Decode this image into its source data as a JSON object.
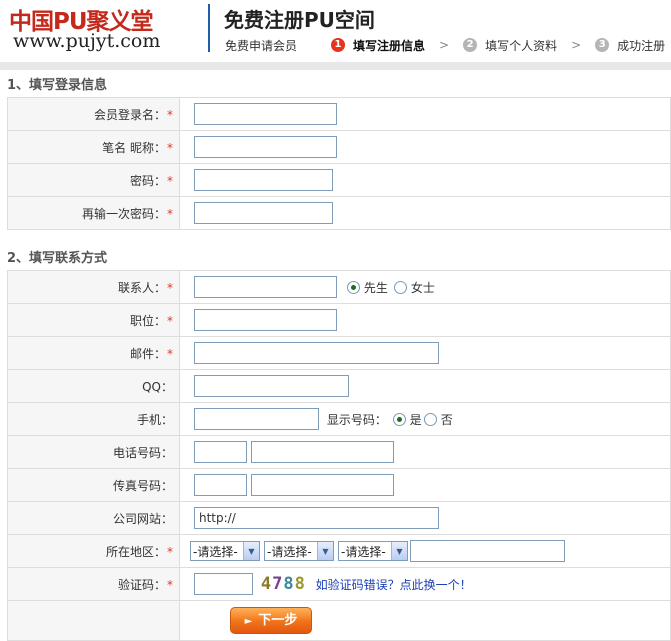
{
  "header": {
    "logo_cn": "中国PU聚义堂",
    "logo_url": "www.pujyt.com",
    "title": "免费注册PU空间",
    "steps": [
      {
        "num": "",
        "label": "免费申请会员"
      },
      {
        "num": "1",
        "label": "填写注册信息"
      },
      {
        "num": "2",
        "label": "填写个人资料"
      },
      {
        "num": "3",
        "label": "成功注册"
      }
    ],
    "separator": ">"
  },
  "section1": {
    "title": "1、填写登录信息",
    "fields": {
      "username": "会员登录名：",
      "nickname": "笔名 昵称：",
      "password": "密码：",
      "password2": "再输一次密码："
    }
  },
  "section2": {
    "title": "2、填写联系方式",
    "fields": {
      "contact": "联系人：",
      "position": "职位：",
      "email": "邮件：",
      "qq": "QQ：",
      "mobile": "手机：",
      "phone": "电话号码：",
      "fax": "传真号码：",
      "website": "公司网站：",
      "region": "所在地区：",
      "captcha": "验证码："
    },
    "gender": {
      "male": "先生",
      "female": "女士",
      "selected": "male"
    },
    "show_number": {
      "label": "显示号码：",
      "yes": "是",
      "no": "否",
      "selected": "yes"
    },
    "website_value": "http://",
    "region_selects": [
      "-请选择-",
      "-请选择-",
      "-请选择-"
    ],
    "captcha_code": [
      "4",
      "7",
      "8",
      "8"
    ],
    "captcha_colors": [
      "#8a7a2a",
      "#7a3f8f",
      "#3a8a9a",
      "#9a9a2a"
    ],
    "captcha_link": "如验证码错误？点此换一个！",
    "next_button": "下一步"
  },
  "required_mark": "*",
  "colors": {
    "brand_red": "#c4291c",
    "accent_blue": "#1f5fa8",
    "button_orange": "#f0731a",
    "link_blue": "#1a3fb5"
  }
}
